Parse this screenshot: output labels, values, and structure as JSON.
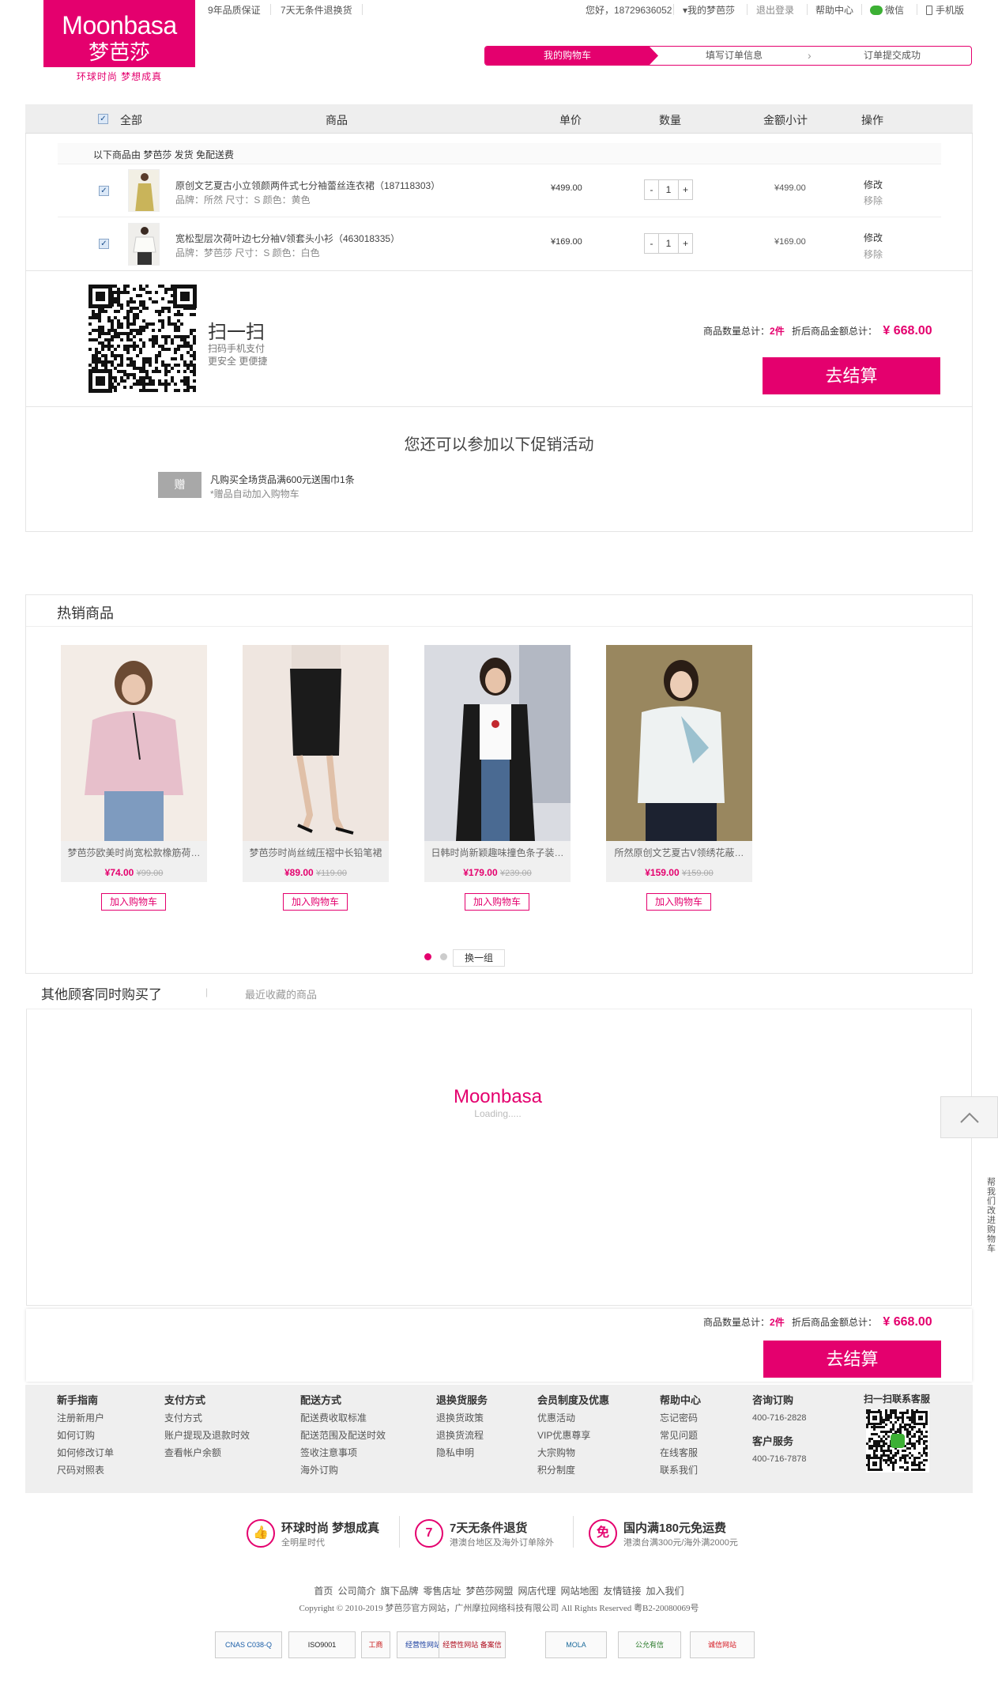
{
  "brand": {
    "name_en": "Moonbasa",
    "name_cn": "梦芭莎",
    "slogan": "环球时尚 梦想成真",
    "color": "#e4006e"
  },
  "topbar": {
    "left": [
      "9年品质保证",
      "7天无条件退换货"
    ],
    "greeting": "您好，18729636052",
    "my_account": "我的梦芭莎",
    "logout": "退出登录",
    "help": "帮助中心",
    "wechat": "微信",
    "mobile": "手机版"
  },
  "steps": [
    "我的购物车",
    "填写订单信息",
    "订单提交成功"
  ],
  "cart": {
    "headers": {
      "all": "全部",
      "product": "商品",
      "price": "单价",
      "qty": "数量",
      "subtotal": "金额小计",
      "action": "操作"
    },
    "notice": "以下商品由 梦芭莎 发货 免配送费",
    "items": [
      {
        "title": "原创文艺夏古小立领颜两件式七分袖蕾丝连衣裙（187118303）",
        "attrs": "品牌：所然    尺寸：S    颜色：黄色",
        "price": "¥499.00",
        "qty": "1",
        "subtotal": "¥499.00",
        "edit": "修改",
        "remove": "移除"
      },
      {
        "title": "宽松型层次荷叶边七分袖V领套头小衫（463018335）",
        "attrs": "品牌：梦芭莎    尺寸：S    颜色：白色",
        "price": "¥169.00",
        "qty": "1",
        "subtotal": "¥169.00",
        "edit": "修改",
        "remove": "移除"
      }
    ],
    "qr_title": "扫一扫",
    "qr_sub1": "扫码手机支付",
    "qr_sub2": "更安全 更便捷",
    "count_label": "商品数量总计：",
    "count_value": "2件",
    "total_label": "折后商品金额总计：",
    "total_value": "¥ 668.00",
    "checkout": "去结算"
  },
  "promo": {
    "title": "您还可以参加以下促销活动",
    "tag": "赠",
    "line1": "凡购买全场货品满600元送围巾1条",
    "line2": "*赠品自动加入购物车"
  },
  "hot": {
    "title": "热销商品",
    "add_label": "加入购物车",
    "swap": "换一组",
    "items": [
      {
        "name": "梦芭莎欧美时尚宽松款橡筋荷…",
        "price": "¥74.00",
        "old": "¥99.00"
      },
      {
        "name": "梦芭莎时尚丝绒压褶中长铅笔裙",
        "price": "¥89.00",
        "old": "¥119.00"
      },
      {
        "name": "日韩时尚新颖趣味撞色条子装…",
        "price": "¥179.00",
        "old": "¥239.00"
      },
      {
        "name": "所然原创文艺夏古V领绣花蔽…",
        "price": "¥159.00",
        "old": "¥159.00"
      }
    ]
  },
  "others": {
    "tab1": "其他顾客同时购买了",
    "tab2": "最近收藏的商品",
    "loading_brand": "Moonbasa",
    "loading": "Loading....."
  },
  "side": {
    "feedback": "帮我们改进购物车"
  },
  "footer": {
    "cols": [
      {
        "h": "新手指南",
        "items": [
          "注册新用户",
          "如何订购",
          "如何修改订单",
          "尺码对照表"
        ]
      },
      {
        "h": "支付方式",
        "items": [
          "支付方式",
          "账户提现及退款时效",
          "查看帐户余额"
        ]
      },
      {
        "h": "配送方式",
        "items": [
          "配送费收取标准",
          "配送范围及配送时效",
          "签收注意事项",
          "海外订购"
        ]
      },
      {
        "h": "退换货服务",
        "items": [
          "退换货政策",
          "退换货流程",
          "隐私申明"
        ]
      },
      {
        "h": "会员制度及优惠",
        "items": [
          "优惠活动",
          "VIP优惠尊享",
          "大宗购物",
          "积分制度"
        ]
      },
      {
        "h": "帮助中心",
        "items": [
          "忘记密码",
          "常见问题",
          "在线客服",
          "联系我们"
        ]
      }
    ],
    "consult_h": "咨询订购",
    "consult_tel": "400-716-2828",
    "service_h": "客户服务",
    "service_tel": "400-716-7878",
    "qr_h": "扫一扫联系客服",
    "promises": [
      {
        "icon": "👍",
        "t": "环球时尚 梦想成真",
        "s": "全明星时代"
      },
      {
        "icon": "7",
        "t": "7天无条件退货",
        "s": "港澳台地区及海外订单除外"
      },
      {
        "icon": "免",
        "t": "国内满180元免运费",
        "s": "港澳台满300元/海外满2000元"
      }
    ],
    "links": [
      "首页",
      "公司简介",
      "旗下品牌",
      "零售店址",
      "梦芭莎网盟",
      "网店代理",
      "网站地图",
      "友情链接",
      "加入我们"
    ],
    "copyright": "Copyright © 2010-2019 梦芭莎官方网站，广州摩拉网络科技有限公司 All Rights Reserved 粤B2-20080069号",
    "badges": [
      "CNAS C038-Q",
      "ISO9001",
      "工商",
      "经营性网站备案",
      "经营性网站 备案信息",
      "MOLA",
      "公允有信",
      "诚信网站"
    ]
  }
}
